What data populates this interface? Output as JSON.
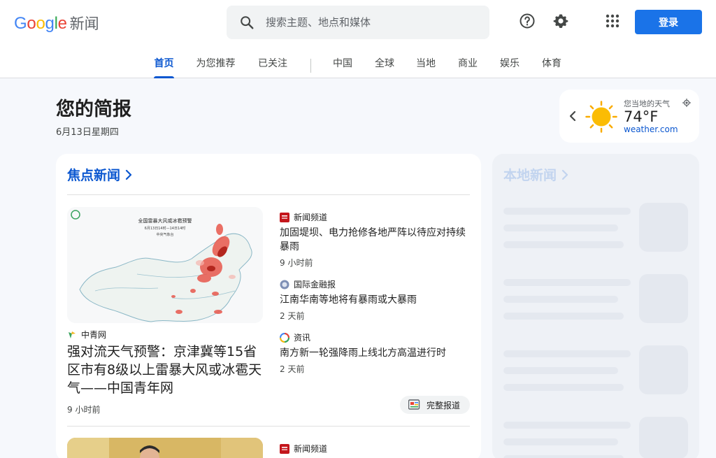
{
  "header": {
    "logo_text": "Google",
    "product": "新闻",
    "search_placeholder": "搜索主题、地点和媒体",
    "signin_label": "登录"
  },
  "tabs": [
    "首页",
    "为您推荐",
    "已关注",
    "中国",
    "全球",
    "当地",
    "商业",
    "娱乐",
    "体育"
  ],
  "briefing": {
    "title": "您的简报",
    "date": "6月13日星期四"
  },
  "weather": {
    "label": "您当地的天气",
    "temp": "74°F",
    "source": "weather.com"
  },
  "top_stories": {
    "title": "焦点新闻",
    "hero": {
      "source": "中青网",
      "headline": "强对流天气预警：京津冀等15省区市有8级以上雷暴大风或冰雹天气——中国青年网",
      "time": "9 小时前",
      "map_title": "全国雷暴大风或冰雹预警",
      "map_date": "6月13日14时—14日14时",
      "map_org": "中央气象台"
    },
    "related": [
      {
        "source": "新闻频道",
        "headline": "加固堤坝、电力抢修各地严阵以待应对持续暴雨",
        "time": "9 小时前"
      },
      {
        "source": "国际金融报",
        "headline": "江南华南等地将有暴雨或大暴雨",
        "time": "2 天前"
      },
      {
        "source": "资讯",
        "headline": "南方新一轮强降雨上线北方高温进行时",
        "time": "2 天前"
      }
    ],
    "full_coverage": "完整报道",
    "next_source": "新闻频道"
  },
  "local_news": {
    "title": "本地新闻"
  },
  "colors": {
    "accent": "#0b57d0",
    "signin": "#1a73e8",
    "background": "#f6f8fc"
  }
}
